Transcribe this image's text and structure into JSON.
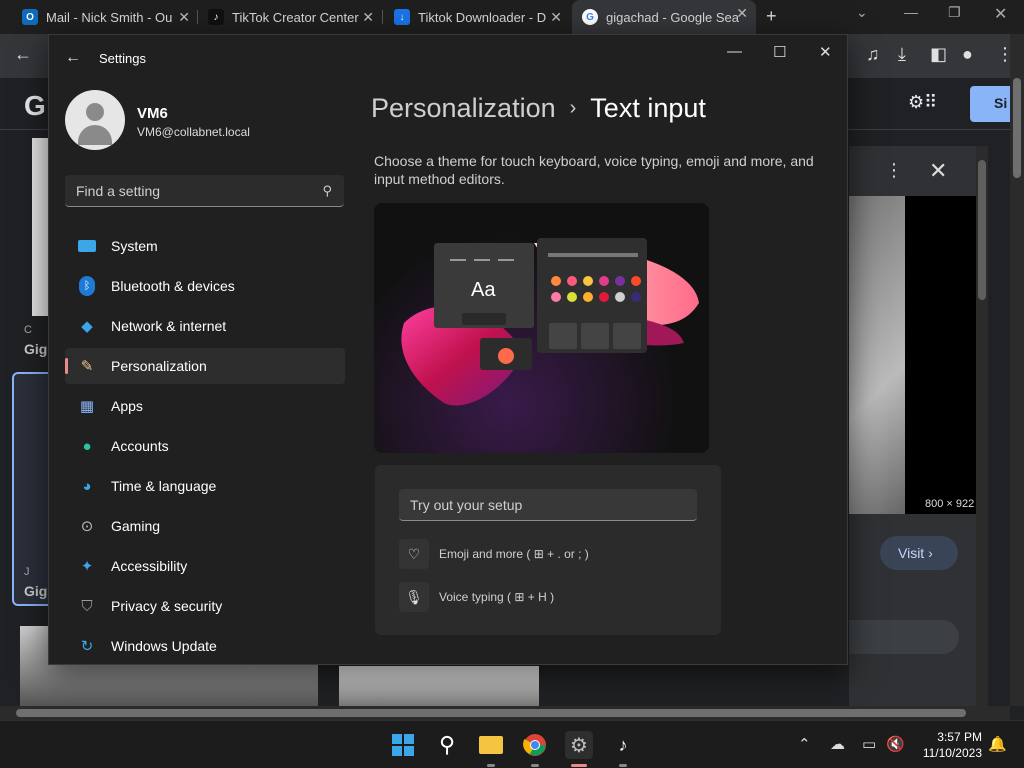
{
  "browser": {
    "tabs": [
      {
        "title": "Mail - Nick Smith - Ou",
        "icon": "outlook-icon"
      },
      {
        "title": "TikTok Creator Center",
        "icon": "tiktok-icon"
      },
      {
        "title": "Tiktok Downloader - D",
        "icon": "download-icon"
      },
      {
        "title": "gigachad - Google Sea",
        "icon": "google-icon"
      }
    ]
  },
  "google": {
    "logo_letter": "G",
    "signin": "Si",
    "image_size": "800 × 922",
    "visit": "Visit",
    "left_caption_1": "Gig",
    "left_caption_2": "Gig",
    "left_source_1": "C",
    "left_source_2": "J"
  },
  "settings": {
    "window_title": "Settings",
    "user": {
      "name": "VM6",
      "email": "VM6@collabnet.local"
    },
    "search_placeholder": "Find a setting",
    "nav": [
      {
        "label": "System",
        "icon": "system-icon"
      },
      {
        "label": "Bluetooth & devices",
        "icon": "bluetooth-icon"
      },
      {
        "label": "Network & internet",
        "icon": "wifi-icon"
      },
      {
        "label": "Personalization",
        "icon": "brush-icon",
        "selected": true
      },
      {
        "label": "Apps",
        "icon": "apps-icon"
      },
      {
        "label": "Accounts",
        "icon": "accounts-icon"
      },
      {
        "label": "Time & language",
        "icon": "globe-clock-icon"
      },
      {
        "label": "Gaming",
        "icon": "gamepad-icon"
      },
      {
        "label": "Accessibility",
        "icon": "accessibility-icon"
      },
      {
        "label": "Privacy & security",
        "icon": "shield-icon"
      },
      {
        "label": "Windows Update",
        "icon": "update-icon"
      }
    ],
    "breadcrumb": {
      "parent": "Personalization",
      "current": "Text input"
    },
    "description": "Choose a theme for touch keyboard, voice typing, emoji and more, and input method editors.",
    "preview_text": "Aa",
    "try_placeholder": "Try out your setup",
    "emoji_hint": "Emoji and more ( ⊞ + . or ; )",
    "voice_hint": "Voice typing ( ⊞ + H )"
  },
  "taskbar": {
    "time": "3:57 PM",
    "date": "11/10/2023"
  }
}
